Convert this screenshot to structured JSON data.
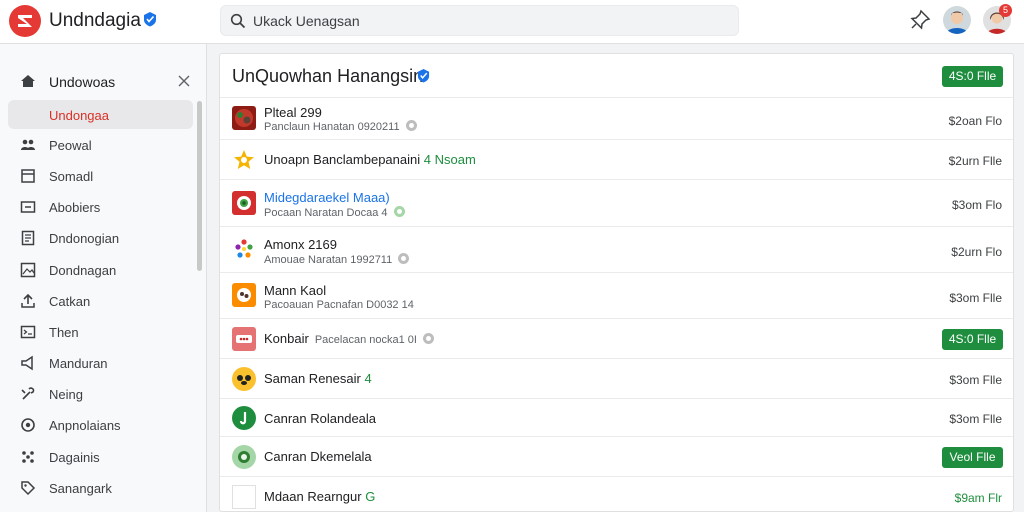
{
  "header": {
    "app_title": "Undndagia",
    "search_placeholder": "Ukack Uenagsan",
    "notification_count": "5",
    "icons": {
      "logo": "brand-logo-icon",
      "verified": "verified-badge-icon",
      "search": "search-icon",
      "pin": "pin-icon"
    }
  },
  "sidebar": {
    "header_label": "Undowoas",
    "active_label": "Undongaa",
    "items": [
      {
        "label": "Peowal",
        "icon": "people-icon"
      },
      {
        "label": "Somadl",
        "icon": "tray-icon"
      },
      {
        "label": "Abobiers",
        "icon": "folder-icon"
      },
      {
        "label": "Dndonogian",
        "icon": "document-icon"
      },
      {
        "label": "Dondnagan",
        "icon": "image-icon"
      },
      {
        "label": "Catkan",
        "icon": "share-icon"
      },
      {
        "label": "Then",
        "icon": "terminal-icon"
      },
      {
        "label": "Manduran",
        "icon": "megaphone-icon"
      },
      {
        "label": "Neing",
        "icon": "tools-icon"
      },
      {
        "label": "Anpnolaians",
        "icon": "target-icon"
      },
      {
        "label": "Dagainis",
        "icon": "apps-icon"
      },
      {
        "label": "Sanangark",
        "icon": "tag-icon"
      }
    ]
  },
  "main": {
    "title": "UnQuowhan Hanangsin",
    "header_button": "4S:0 Flle",
    "rows": [
      {
        "name": "Plteal 299",
        "name_accent": "",
        "sub": "Panclaun Hanatan 0920211",
        "right": "$2oan Flo",
        "button": ""
      },
      {
        "name": "Unoapn Banclambepanaini",
        "name_accent": "4 Nsoam",
        "sub": "",
        "right": "$2urn Flle",
        "button": ""
      },
      {
        "name": "Midegdaraekel Maaa)",
        "name_accent": "",
        "sub": "Pocaan Naratan Docaa 4",
        "right": "$3om Flo",
        "button": ""
      },
      {
        "name": "Amonx 2169",
        "name_accent": "",
        "sub": "Amouae Naratan 1992711",
        "right": "$2urn Flo",
        "button": ""
      },
      {
        "name": "Mann Kaol",
        "name_accent": "",
        "sub": "Pacoauan Pacnafan D0032 14",
        "right": "$3om Flle",
        "button": ""
      },
      {
        "name": "Konbair",
        "name_accent": "",
        "sub": "Pacelacan nocka1 0I",
        "right": "",
        "button": "4S:0 Flle"
      },
      {
        "name": "Saman Renesair",
        "name_accent": "4",
        "sub": "",
        "right": "$3om Flle",
        "button": ""
      },
      {
        "name": "Canran Rolandeala",
        "name_accent": "",
        "sub": "",
        "right": "$3om Flle",
        "button": ""
      },
      {
        "name": "Canran Dkemelala",
        "name_accent": "",
        "sub": "",
        "right": "",
        "button": "Veol Flle"
      },
      {
        "name": "Mdaan Rearngur",
        "name_accent": "G",
        "sub": "",
        "right": "$9am Flr",
        "button": ""
      }
    ]
  },
  "colors": {
    "brand": "#e53935",
    "accent_green": "#1e8e3e",
    "link_blue": "#1a73e8",
    "active_text": "#d93025"
  }
}
